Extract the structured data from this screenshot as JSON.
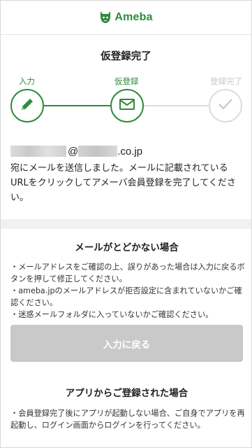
{
  "header": {
    "logo_text": "Ameba"
  },
  "page": {
    "title": "仮登録完了"
  },
  "steps": [
    {
      "label": "入力",
      "state": "done",
      "icon": "pencil-icon"
    },
    {
      "label": "仮登録",
      "state": "current",
      "icon": "mail-icon"
    },
    {
      "label": "登録完了",
      "state": "pending",
      "icon": "check-icon"
    }
  ],
  "confirmation": {
    "email_at": "@",
    "email_domain": ".co.jp",
    "message": "宛にメールを送信しました。メールに記載されているURLをクリックしてアメーバ会員登録を完了してください。"
  },
  "no_mail_section": {
    "title": "メールがとどかない場合",
    "items": [
      "・メールアドレスをご確認の上、誤りがあった場合は入力に戻るボタンを押して修正してください。",
      "・ameba.jpのメールアドレスが拒否設定に含まれていないかご確認ください。",
      "・迷惑メールフォルダに入っていないかご確認ください。"
    ],
    "back_button_label": "入力に戻る"
  },
  "app_section": {
    "title": "アプリからご登録された場合",
    "items": [
      "・会員登録完了後にアプリが起動しない場合、ご自身でアプリを再起動し、ログイン画面からログインを行ってください。"
    ]
  },
  "colors": {
    "brand_green": "#2d8c3c",
    "inactive_gray": "#c8c8c8",
    "button_disabled": "#c9c9c9"
  }
}
